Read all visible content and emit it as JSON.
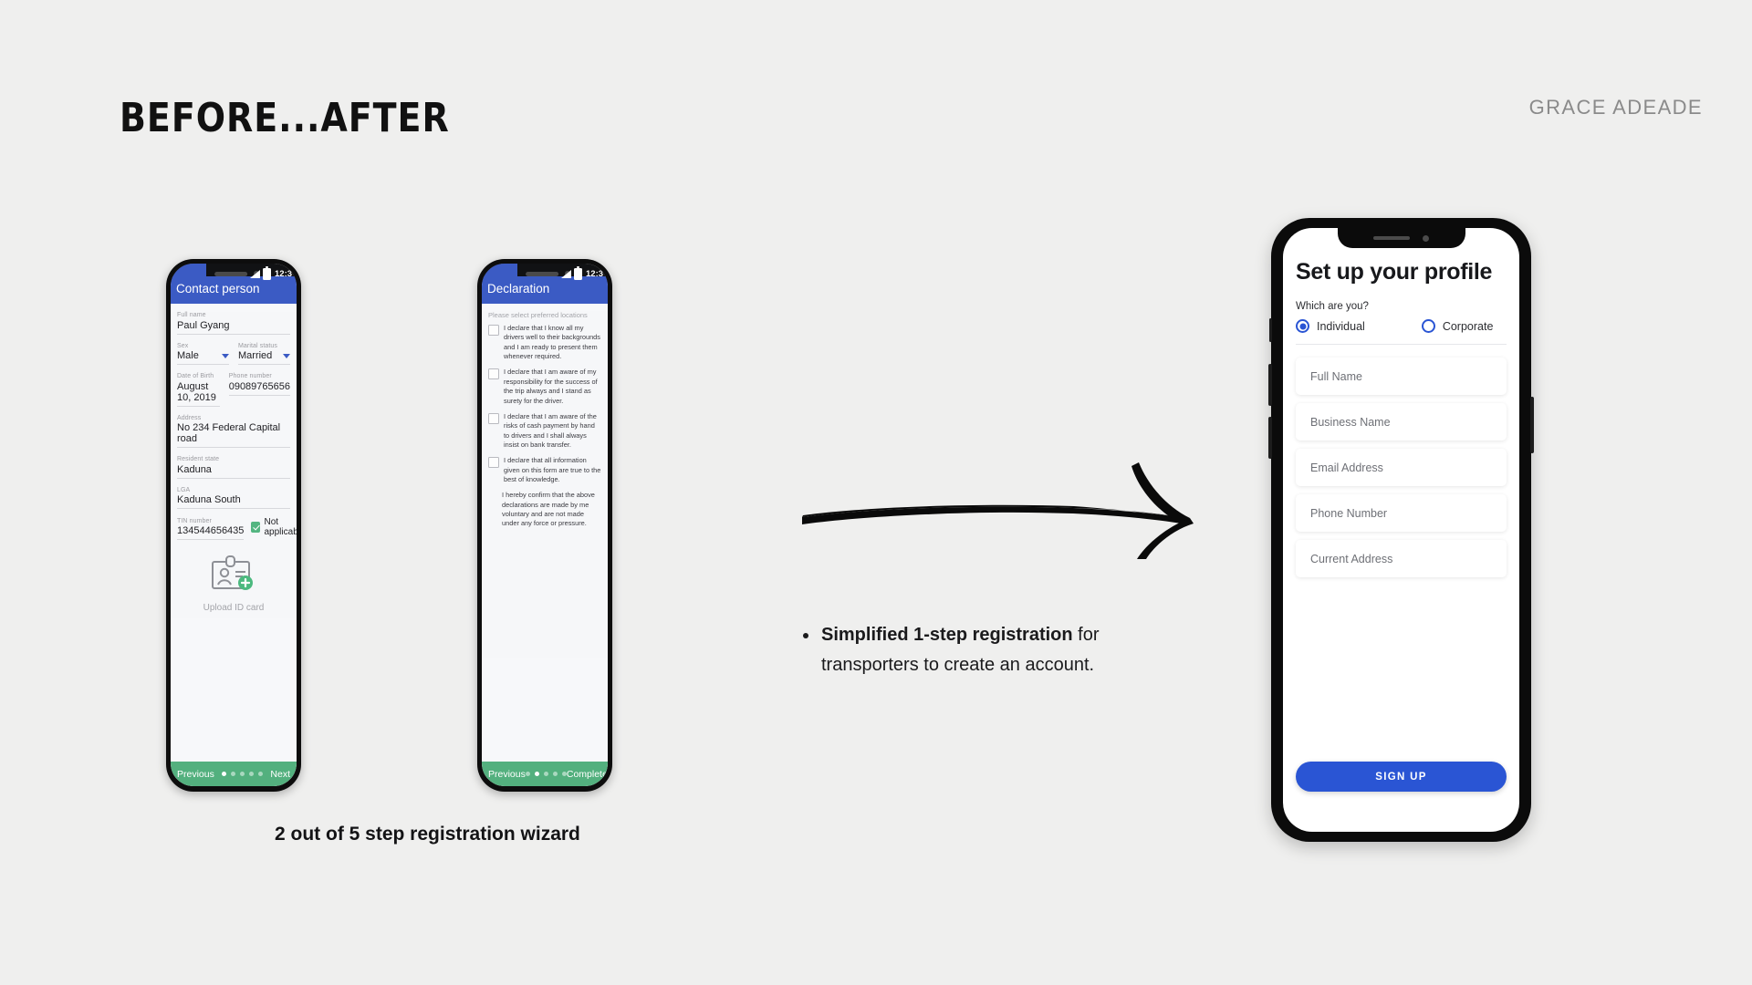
{
  "slide": {
    "title": "BEFORE...AFTER",
    "author": "GRACE ADEADE",
    "background_color": "#efefee"
  },
  "colors": {
    "android_appbar_blue": "#3b5bc4",
    "android_footer_green": "#53b07e",
    "checkbox_green": "#53b581",
    "iphone_accent_blue": "#2a55d4",
    "author_gray": "#8a8a8a"
  },
  "arrow": {
    "name": "hand-drawn-arrow",
    "direction": "right"
  },
  "phone_before_1": {
    "status_bar": {
      "time": "12:3",
      "signal_icon": "signal-triangle-icon",
      "battery_icon": "battery-icon"
    },
    "appbar_title": "Contact person",
    "fields": [
      {
        "label": "Full name",
        "value": "Paul Gyang",
        "type": "text"
      },
      {
        "label": "Sex",
        "value": "Male",
        "type": "select"
      },
      {
        "label": "Marital status",
        "value": "Married",
        "type": "select"
      },
      {
        "label": "Date of Birth",
        "value": "August 10, 2019",
        "type": "text"
      },
      {
        "label": "Phone number",
        "value": "09089765656",
        "type": "text"
      },
      {
        "label": "Address",
        "value": "No 234 Federal Capital road",
        "type": "text"
      },
      {
        "label": "Resident state",
        "value": "Kaduna",
        "type": "text"
      },
      {
        "label": "LGA",
        "value": "Kaduna South",
        "type": "text"
      },
      {
        "label": "TIN number",
        "value": "134544656435",
        "type": "text"
      }
    ],
    "not_applicable": {
      "label": "Not applicable",
      "checked": true
    },
    "upload": {
      "caption": "Upload ID card",
      "icon": "id-card-upload-icon"
    },
    "footer": {
      "previous_label": "Previous",
      "next_label": "Next",
      "steps_total": 5,
      "step_active": 1
    }
  },
  "phone_before_2": {
    "status_bar": {
      "time": "12:3",
      "signal_icon": "signal-triangle-icon",
      "battery_icon": "battery-icon"
    },
    "appbar_title": "Declaration",
    "hint": "Please select preferred locations",
    "declarations": [
      {
        "text": "I declare that I know all my drivers well to their backgrounds and I am ready to present them whenever required.",
        "checked": false
      },
      {
        "text": "I declare that I am aware  of my responsibility for the success of the trip always and I stand as surety for the driver.",
        "checked": false
      },
      {
        "text": "I declare that I am aware of the risks of cash payment by hand to drivers and I shall always insist on bank transfer.",
        "checked": false
      },
      {
        "text": "I declare that all information given on this form are true to the best of knowledge.",
        "checked": false
      }
    ],
    "note": "I hereby confirm that the above declarations are made by me voluntary and are not made under any force or pressure.",
    "footer": {
      "previous_label": "Previous",
      "next_label": "Complete",
      "steps_total": 5,
      "step_active": 2
    }
  },
  "phone_after": {
    "title": "Set up your profile",
    "question": "Which are you?",
    "options": [
      {
        "label": "Individual",
        "selected": true
      },
      {
        "label": "Corporate",
        "selected": false
      }
    ],
    "inputs": [
      {
        "placeholder": "Full Name"
      },
      {
        "placeholder": "Business Name"
      },
      {
        "placeholder": "Email Address"
      },
      {
        "placeholder": "Phone Number"
      },
      {
        "placeholder": "Current Address"
      }
    ],
    "submit_label": "SIGN UP"
  },
  "captions": {
    "before": "2 out of 5 step registration wizard",
    "after_bullet_bold": "Simplified 1-step registration",
    "after_bullet_rest": " for transporters to create an account."
  }
}
